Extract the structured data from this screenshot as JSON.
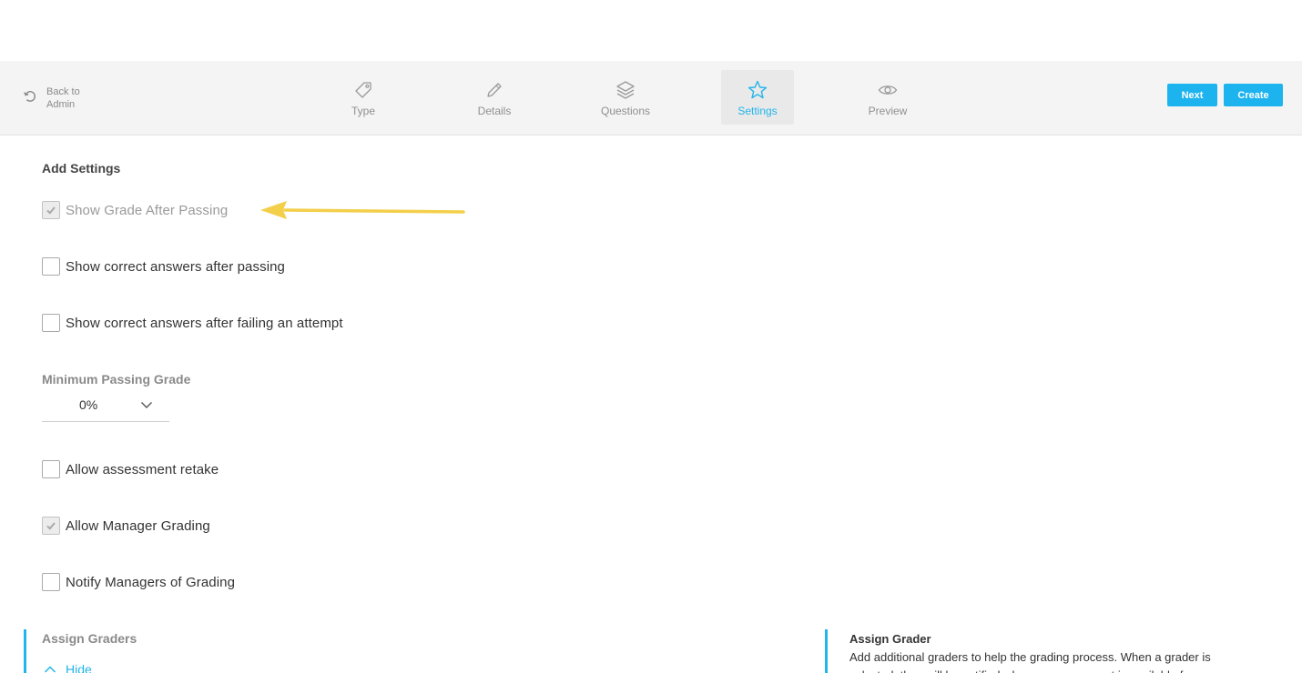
{
  "header": {
    "back_label": "Back to Admin",
    "steps": [
      {
        "label": "Type",
        "icon": "tag-icon"
      },
      {
        "label": "Details",
        "icon": "pencil-icon"
      },
      {
        "label": "Questions",
        "icon": "layers-icon"
      },
      {
        "label": "Settings",
        "icon": "star-icon",
        "active": true
      },
      {
        "label": "Preview",
        "icon": "eye-icon"
      }
    ],
    "next_label": "Next",
    "create_label": "Create"
  },
  "settings": {
    "title": "Add Settings",
    "options": [
      {
        "label": "Show Grade After Passing",
        "checked": true,
        "disabled": true
      },
      {
        "label": "Show correct answers after passing",
        "checked": false
      },
      {
        "label": "Show correct answers after failing an attempt",
        "checked": false
      }
    ],
    "min_passing_grade": {
      "label": "Minimum Passing Grade",
      "value": "0%"
    },
    "options2": [
      {
        "label": "Allow assessment retake",
        "checked": false
      },
      {
        "label": "Allow Manager Grading",
        "checked": true
      },
      {
        "label": "Notify Managers of Grading",
        "checked": false
      }
    ]
  },
  "graders": {
    "title": "Assign Graders",
    "hide_label": "Hide"
  },
  "help": {
    "title": "Assign Grader",
    "text": "Add additional graders to help the grading process. When a grader is selected, they will be notified when an assessment is available for"
  },
  "colors": {
    "accent": "#1db3ef",
    "annotation_arrow": "#f3cf4a"
  }
}
